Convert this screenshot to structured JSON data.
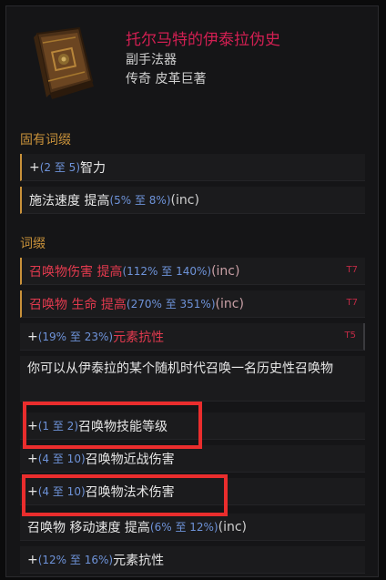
{
  "item": {
    "name": "托尔马特的伊泰拉伪史",
    "type": "副手法器",
    "rarity": "传奇 皮革巨著",
    "icon": "book-icon"
  },
  "implicit": {
    "title": "固有词缀",
    "rows": [
      {
        "pre": "+",
        "num": "(2 至 5)",
        "text": " 智力",
        "inc": ""
      },
      {
        "pre": "施法速度 提高 ",
        "num": "(5% 至 8%)",
        "text": "",
        "inc": " (inc)"
      }
    ]
  },
  "affixes": {
    "title": "词缀",
    "rows": [
      {
        "pre": "召唤物伤害 提高 ",
        "num": "(112% 至 140%)",
        "text": "",
        "inc": " (inc)",
        "tier": "T7"
      },
      {
        "pre": "召唤物 生命 提高 ",
        "num": "(270% 至 351%)",
        "text": "",
        "inc": " (inc)",
        "tier": "T7"
      },
      {
        "pre": "+",
        "num": "(19% 至 23%)",
        "text": " 元素抗性",
        "inc": "",
        "tier": "T5"
      },
      {
        "text": "你可以从伊泰拉的某个随机时代召唤一名历史性召唤物"
      },
      {
        "pre": "+",
        "num": "(1 至 2)",
        "text": " 召唤物技能等级"
      },
      {
        "pre": "+",
        "num": "(4 至 10)",
        "text": " 召唤物近战伤害"
      },
      {
        "pre": "+",
        "num": "(4 至 10)",
        "text": " 召唤物法术伤害"
      },
      {
        "pre": "召唤物 移动速度 提高 ",
        "num": "(6% 至 12%)",
        "text": "",
        "inc": " (inc)"
      },
      {
        "pre": "+",
        "num": "(12% 至 16%)",
        "text": " 元素抗性"
      }
    ]
  },
  "colors": {
    "unique_name": "#d21f52",
    "section_title": "#c8913a",
    "range_value": "#6e93d9",
    "highlight_box": "#ea2d2d"
  }
}
